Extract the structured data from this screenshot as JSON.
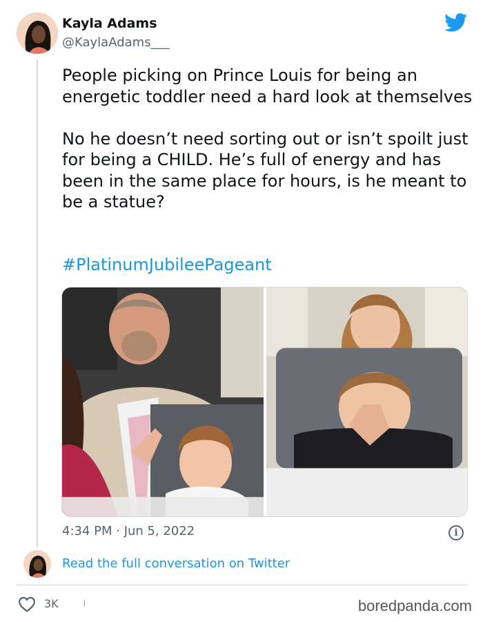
{
  "tweet": {
    "author_name": "Kayla Adams",
    "author_handle": "@KaylaAdams___",
    "text": "People picking on Prince Louis for being an energetic toddler need a hard look at themselves\n\nNo he doesn’t need sorting out or isn’t spoilt just for being a CHILD. He’s full of energy and has been in the same place for hours, is he meant to be a statue?",
    "hashtag": "#PlatinumJubileePageant",
    "timestamp": "4:34 PM · Jun 5, 2022",
    "info_icon_glyph": "i",
    "read_link": "Read the full conversation on Twitter",
    "likes": "3K"
  },
  "icons": {
    "platform": "twitter-bird-icon",
    "info": "info-icon",
    "like": "heart-icon"
  },
  "colors": {
    "link": "#1b95e0",
    "twitter_blue": "#1d9bf0",
    "muted": "#536471"
  },
  "watermark": "boredpanda.com"
}
